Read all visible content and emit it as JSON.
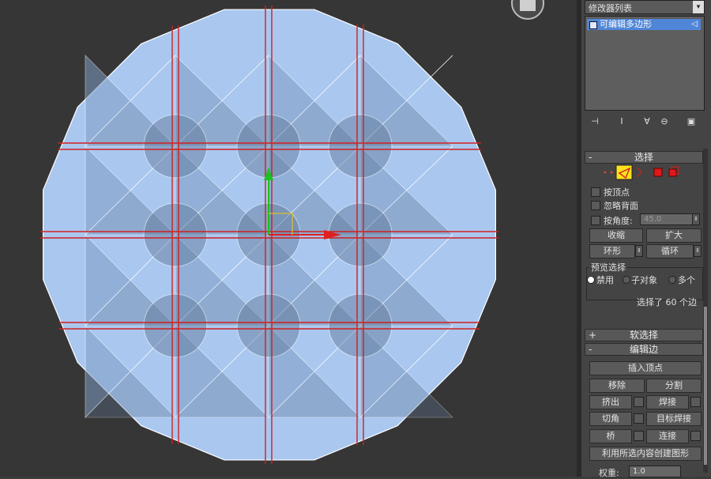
{
  "panel": {
    "modifier_list_label": "修改器列表",
    "dropdown_arrow": "▾",
    "stack_item_label": "可编辑多边形",
    "toolbar_icons": [
      "pin-stack-icon",
      "show-end-result-icon",
      "make-unique-icon",
      "remove-modifier-icon",
      "configure-sets-icon"
    ]
  },
  "selection": {
    "title": "选择",
    "collapse": "-",
    "by_vertex": "按顶点",
    "ignore_backfacing": "忽略背面",
    "by_angle": "按角度:",
    "angle_value": "45.0",
    "shrink": "收缩",
    "grow": "扩大",
    "ring": "环形",
    "loop": "循环",
    "preview_title": "预览选择",
    "preview_disabled": "禁用",
    "preview_subobject": "子对象",
    "preview_multi": "多个",
    "status": "选择了 60 个边"
  },
  "soft_selection": {
    "title": "软选择",
    "expand": "+"
  },
  "edit_edges": {
    "title": "编辑边",
    "collapse": "-",
    "insert_vertex": "插入顶点",
    "remove": "移除",
    "split": "分割",
    "extrude": "挤出",
    "weld": "焊接",
    "chamfer": "切角",
    "target_weld": "目标焊接",
    "bridge": "桥",
    "connect": "连接",
    "create_shape": "利用所选内容创建图形",
    "weight_label": "权重:",
    "weight_value": "1.0"
  },
  "colors": {
    "mesh_fill": "#a9c7ef",
    "mesh_shade": "#7f9cc4",
    "mesh_dark": "#5e7696",
    "selected_edge": "#d02020",
    "stack_highlight": "#4f86d8",
    "active_mode": "#ffe21a"
  }
}
